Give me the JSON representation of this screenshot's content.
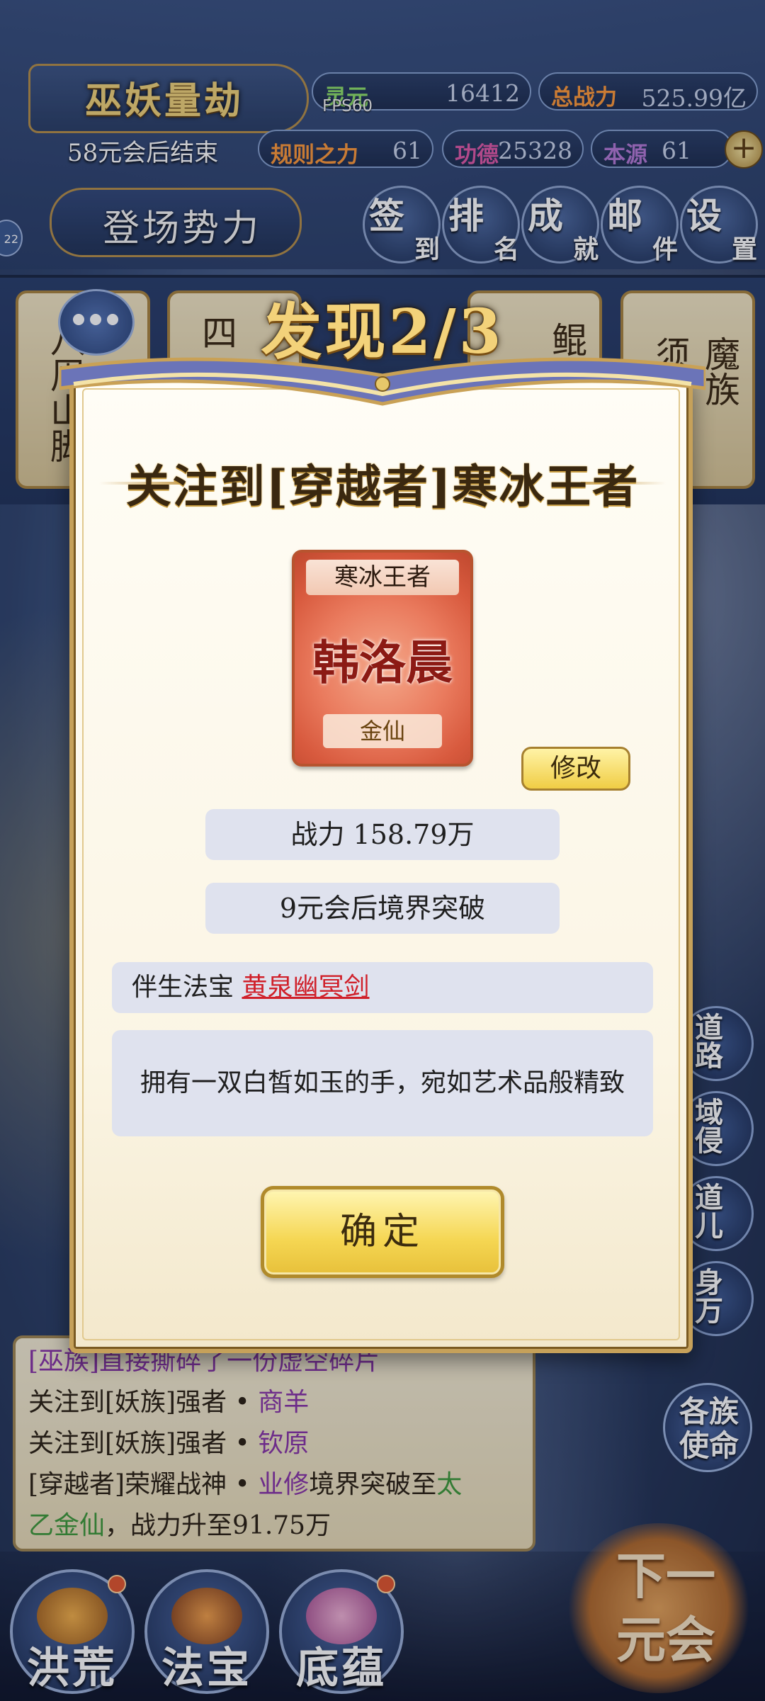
{
  "hud": {
    "event_title": "巫妖量劫",
    "event_sub": "58元会后结束",
    "stats": [
      {
        "label": "灵元",
        "value": "16412",
        "color": "#8fe06a"
      },
      {
        "label": "总战力",
        "value": "525.99亿",
        "color": "#ff9a3a"
      },
      {
        "label": "规则之力",
        "value": "61",
        "color": "#ff9a3a"
      },
      {
        "label": "功德",
        "value": "25328",
        "color": "#e05aa8"
      },
      {
        "label": "本源",
        "value": "61",
        "color": "#b57ad6"
      }
    ],
    "fps": "FPS60",
    "faction_label": "登场势力",
    "side_badge": "22",
    "buttons": [
      {
        "a": "签",
        "b": "到"
      },
      {
        "a": "排",
        "b": "名"
      },
      {
        "a": "成",
        "b": "就"
      },
      {
        "a": "邮",
        "b": "件"
      },
      {
        "a": "设",
        "b": "置"
      }
    ]
  },
  "faction_cards": [
    "八周山脚",
    "四",
    "鲲",
    "须",
    "魔族"
  ],
  "side_menu": [
    "道路",
    "域侵",
    "道儿",
    "身万",
    "各族使命"
  ],
  "log": [
    {
      "type": "plain",
      "text": "[巫族]直接撕碎了一份虚空碎片"
    },
    {
      "type": "mix",
      "prefix": "关注到[妖族]强者 • ",
      "name": "商羊"
    },
    {
      "type": "mix",
      "prefix": "关注到[妖族]强者 • ",
      "name": "钦原"
    },
    {
      "type": "rise",
      "p1": "[穿越者]荣耀战神 • ",
      "name": "业修",
      "p2": "境界突破至",
      "realm1": "太",
      "realm2": "乙金仙",
      "p3": "，战力升至91.75万"
    }
  ],
  "bottom_nav": [
    {
      "label": "洪荒",
      "icon": "tree-icon"
    },
    {
      "label": "法宝",
      "icon": "cauldron-icon"
    },
    {
      "label": "底蕴",
      "icon": "lotus-icon"
    }
  ],
  "next_button": "下一元会",
  "modal": {
    "discover": "发现2/3",
    "headline": "关注到[穿越者]寒冰王者",
    "card": {
      "title": "寒冰王者",
      "name": "韩洛晨",
      "rank": "金仙"
    },
    "edit": "修改",
    "power": "战力 158.79万",
    "breakthrough": "9元会后境界突破",
    "treasure_label": "伴生法宝",
    "treasure_name": "黄泉幽冥剑",
    "description": "拥有一双白皙如玉的手，宛如艺术品般精致",
    "confirm": "确定"
  }
}
